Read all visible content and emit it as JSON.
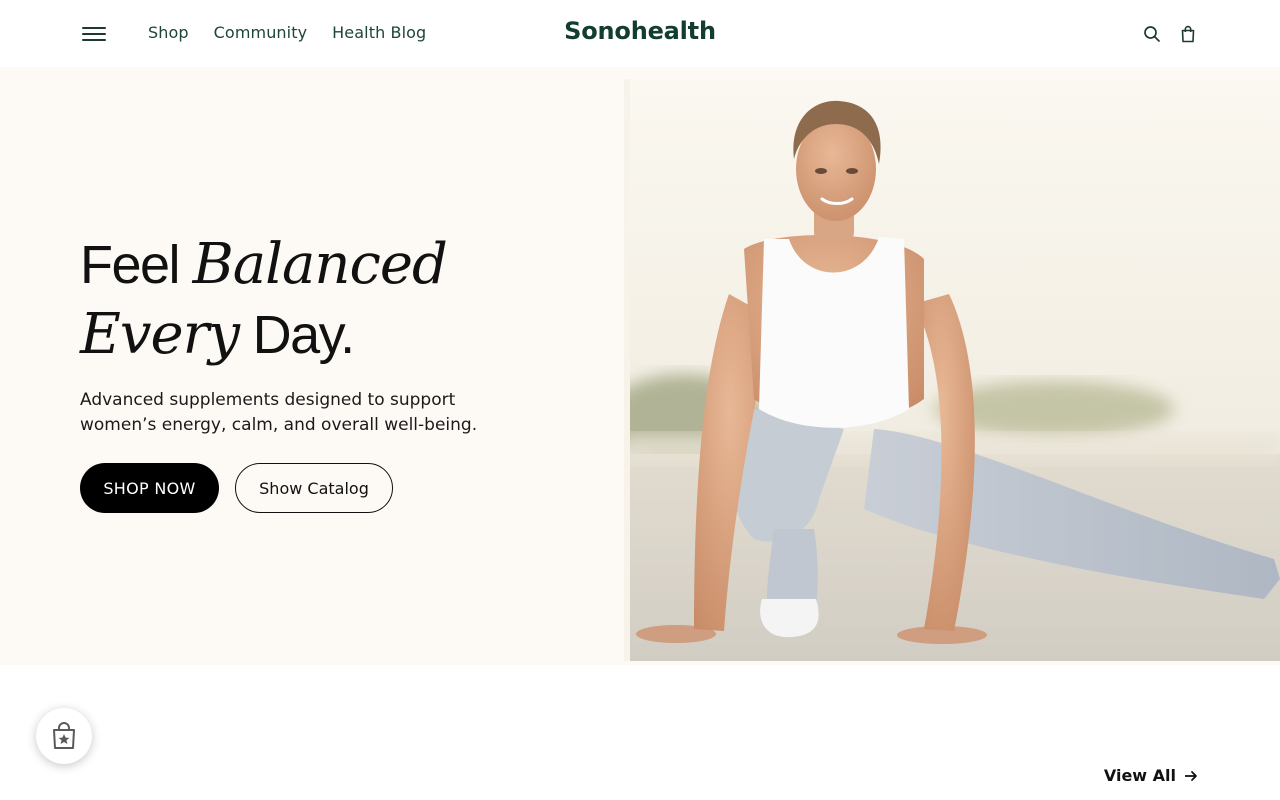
{
  "header": {
    "menu_icon": "hamburger-menu-icon",
    "nav": [
      {
        "label": "Shop"
      },
      {
        "label": "Community"
      },
      {
        "label": "Health Blog"
      }
    ],
    "logo": "Sonohealth",
    "icons": [
      "search-icon",
      "shopping-bag-icon"
    ]
  },
  "hero": {
    "title_word_1": "Feel",
    "title_word_2": "Balanced",
    "title_word_3": "Every",
    "title_word_4": "Day.",
    "subtitle": "Advanced supplements designed to support women’s energy, calm, and overall well-being.",
    "primary_button": "SHOP NOW",
    "secondary_button": "Show Catalog",
    "image": "woman-stretching-photo"
  },
  "floating_badge": {
    "icon": "rewards-bag-star-icon"
  },
  "products": {
    "view_all_label": "View All",
    "view_all_icon": "arrow-right-icon"
  },
  "colors": {
    "brand_green": "#133d2d",
    "hero_bg": "#fdf9f5",
    "primary_button": "#000000"
  }
}
